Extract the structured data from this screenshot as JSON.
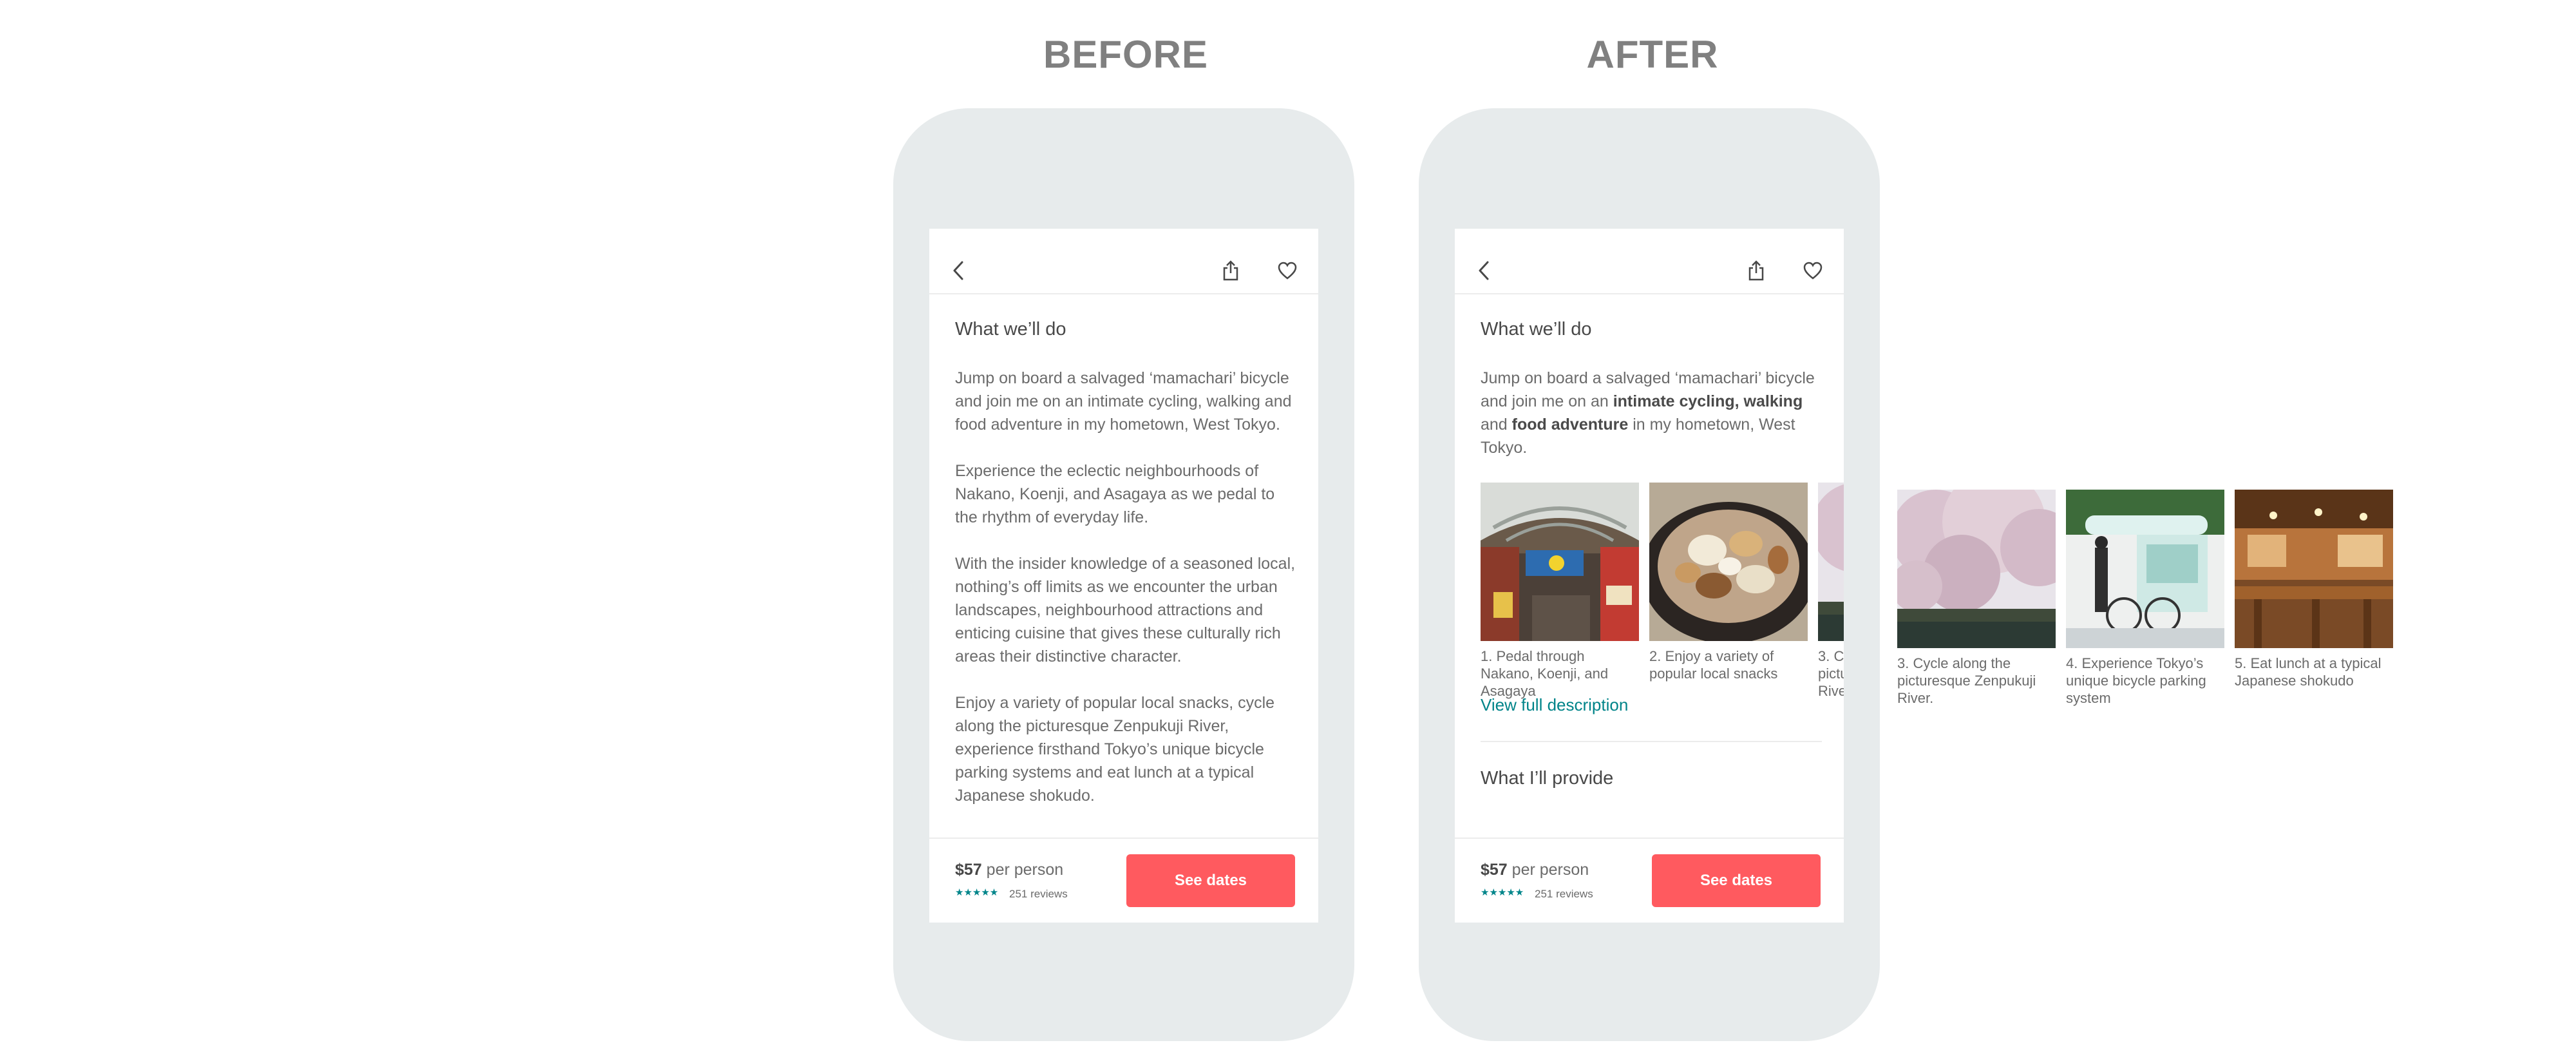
{
  "labels": {
    "before": "BEFORE",
    "after": "AFTER"
  },
  "section_title": "What we’ll do",
  "before": {
    "paragraphs": [
      "Jump on board a salvaged ‘mamachari’ bicycle and join me on an intimate cycling, walking and food adventure in my hometown, West Tokyo.",
      "Experience the eclectic neighbourhoods of Nakano, Koenji, and Asagaya as we pedal to the rhythm of everyday life.",
      "With the insider knowledge of a seasoned local, nothing’s off limits as we encounter the urban landscapes, neighbourhood attractions and enticing cuisine that gives these culturally rich areas their distinctive character.",
      "Enjoy a variety of popular local snacks, cycle along the picturesque Zenpukuji River, experience firsthand Tokyo’s unique bicycle parking systems and eat lunch at a typical Japanese shokudo."
    ]
  },
  "after": {
    "intro": {
      "p1": "Jump on board a salvaged ‘mamachari’ bicycle and join me on an ",
      "b1": "intimate cycling, walking",
      "p2": " and ",
      "b2": "food adventure",
      "p3": " in my hometown, West Tokyo."
    },
    "view_full": "View full description",
    "provide_title": "What I’ll provide"
  },
  "gallery": [
    {
      "caption": "1. Pedal through Nakano, Koenji, and Asagaya",
      "icon": "shopping-arcade-photo"
    },
    {
      "caption": "2. Enjoy a variety of popular local snacks",
      "icon": "oden-food-photo"
    },
    {
      "caption": "3. Cycle along the picturesque Zenpukuji River.",
      "icon": "cherry-blossom-photo"
    },
    {
      "caption": "4. Experience Tokyo’s unique bicycle parking system",
      "icon": "bicycle-kiosk-photo"
    },
    {
      "caption": "5. Eat lunch at a typical Japanese shokudo",
      "icon": "restaurant-photo"
    }
  ],
  "footer": {
    "price": "$57",
    "per_person": " per person",
    "stars": "★★★★★",
    "reviews": "251 reviews",
    "cta": "See dates"
  },
  "colors": {
    "accent": "#ff5a5f",
    "teal": "#008489",
    "device": "#e7ebec"
  }
}
